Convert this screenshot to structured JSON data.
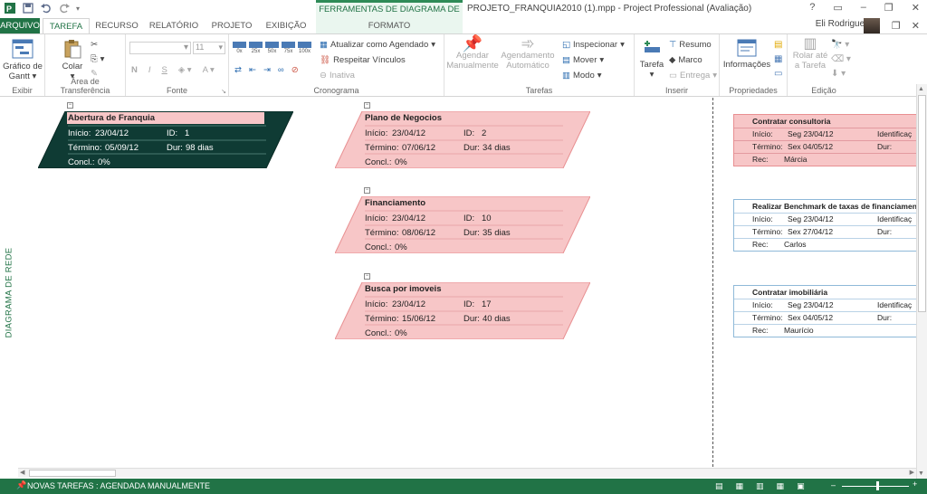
{
  "window": {
    "context_group": "FERRAMENTAS DE DIAGRAMA DE REDE",
    "doc_title": "PROJETO_FRANQUIA2010 (1).mpp - Project Professional (Avaliação)",
    "controls": [
      "?",
      "▭",
      "–",
      "❐",
      "✕"
    ]
  },
  "tabs": {
    "arquivo": "ARQUIVO",
    "tarefa": "TAREFA",
    "recurso": "RECURSO",
    "relatorio": "RELATÓRIO",
    "projeto": "PROJETO",
    "exibicao": "EXIBIÇÃO",
    "formato": "FORMATO"
  },
  "user": {
    "name": "Eli Rodrigues"
  },
  "ribbon": {
    "exibir": {
      "label": "Exibir",
      "gantt": "Gráfico de\nGantt"
    },
    "clipboard": {
      "label": "Área de Transferência",
      "paste": "Colar"
    },
    "fonte": {
      "label": "Fonte",
      "font_name": "",
      "font_size": "11",
      "bold": "N",
      "italic": "I",
      "underline": "S"
    },
    "cronograma": {
      "label": "Cronograma",
      "percents": [
        "0x",
        "25x",
        "50x",
        "75x",
        "100x"
      ],
      "update": "Atualizar como Agendado",
      "respect": "Respeitar Vínculos",
      "inactive": "Inativa"
    },
    "tarefas": {
      "label": "Tarefas",
      "manual": "Agendar\nManualmente",
      "auto": "Agendamento\nAutomático",
      "inspect": "Inspecionar",
      "move": "Mover",
      "mode": "Modo"
    },
    "inserir": {
      "label": "Inserir",
      "task": "Tarefa",
      "summary": "Resumo",
      "milestone": "Marco",
      "deliverable": "Entrega"
    },
    "propriedades": {
      "label": "Propriedades",
      "info": "Informações"
    },
    "edicao": {
      "label": "Edição",
      "scroll": "Rolar até\na Tarefa"
    }
  },
  "sidebar": {
    "view_label": "DIAGRAMA DE REDE"
  },
  "nodes": [
    {
      "title": "Abertura de Franquia",
      "inicio_label": "Início:",
      "inicio": "23/04/12",
      "id_label": "ID:",
      "id": "1",
      "termino_label": "Término:",
      "termino": "05/09/12",
      "dur_label": "Dur:",
      "dur": "98 dias",
      "concl_label": "Concl.:",
      "concl": "0%"
    },
    {
      "title": "Plano de Negocios",
      "inicio_label": "Início:",
      "inicio": "23/04/12",
      "id_label": "ID:",
      "id": "2",
      "termino_label": "Término:",
      "termino": "07/06/12",
      "dur_label": "Dur:",
      "dur": "34 dias",
      "concl_label": "Concl.:",
      "concl": "0%"
    },
    {
      "title": "Financiamento",
      "inicio_label": "Início:",
      "inicio": "23/04/12",
      "id_label": "ID:",
      "id": "10",
      "termino_label": "Término:",
      "termino": "08/06/12",
      "dur_label": "Dur:",
      "dur": "35 dias",
      "concl_label": "Concl.:",
      "concl": "0%"
    },
    {
      "title": "Busca por imoveis",
      "inicio_label": "Início:",
      "inicio": "23/04/12",
      "id_label": "ID:",
      "id": "17",
      "termino_label": "Término:",
      "termino": "15/06/12",
      "dur_label": "Dur:",
      "dur": "40 dias",
      "concl_label": "Concl.:",
      "concl": "0%"
    }
  ],
  "task_boxes": [
    {
      "title": "Contratar consultoria",
      "inicio_label": "Início:",
      "inicio": "Seg 23/04/12",
      "id_label": "Identificaç",
      "termino_label": "Término:",
      "termino": "Sex 04/05/12",
      "dur_label": "Dur:",
      "rec_label": "Rec:",
      "rec": "Márcia"
    },
    {
      "title": "Realizar Benchmark de taxas de financiament",
      "inicio_label": "Início:",
      "inicio": "Seg 23/04/12",
      "id_label": "Identificaç",
      "termino_label": "Término:",
      "termino": "Sex 27/04/12",
      "dur_label": "Dur:",
      "rec_label": "Rec:",
      "rec": "Carlos"
    },
    {
      "title": "Contratar imobiliária",
      "inicio_label": "Início:",
      "inicio": "Seg 23/04/12",
      "id_label": "Identificaç",
      "termino_label": "Término:",
      "termino": "Sex 04/05/12",
      "dur_label": "Dur:",
      "rec_label": "Rec:",
      "rec": "Maurício"
    }
  ],
  "status": {
    "message": "NOVAS TAREFAS : AGENDADA MANUALMENTE"
  },
  "colors": {
    "accent": "#217346",
    "critical_fill": "#f7c6c7",
    "critical_border": "#e88f91",
    "summary_fill": "#0f3b34",
    "task_border": "#8fb9d8"
  }
}
